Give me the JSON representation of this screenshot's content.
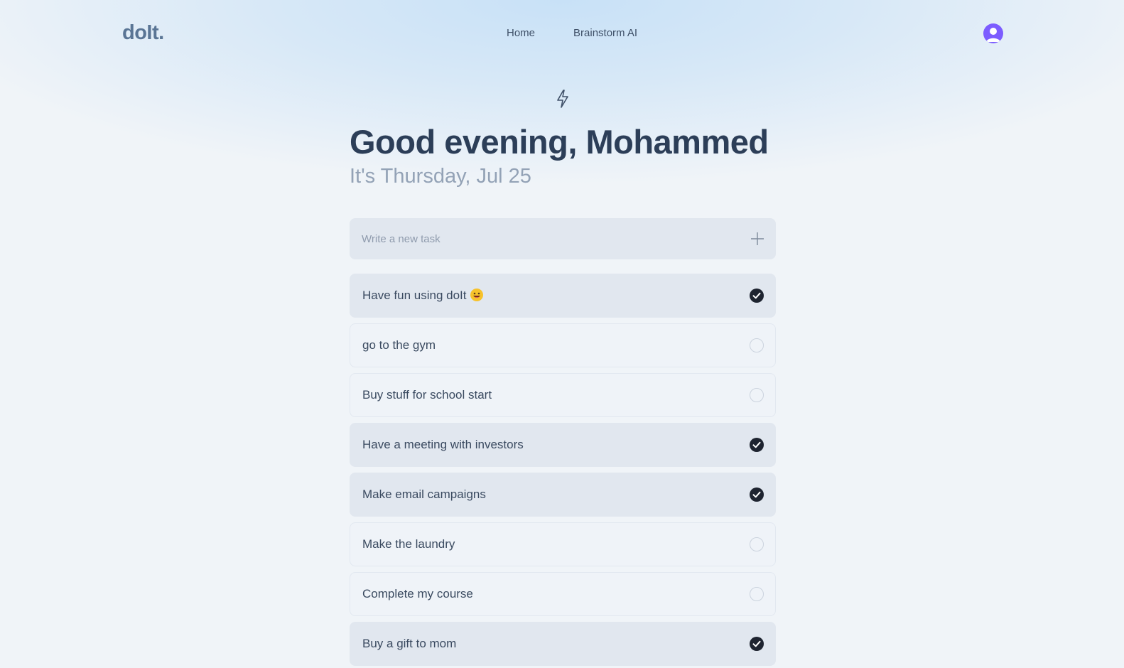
{
  "app": {
    "logo": "doIt."
  },
  "nav": {
    "items": [
      {
        "label": "Home"
      },
      {
        "label": "Brainstorm AI"
      }
    ]
  },
  "user": {
    "avatar_icon": "user-avatar-icon",
    "avatar_color": "#7c5cff"
  },
  "hero": {
    "icon": "lightning-bolt-icon",
    "greeting": "Good evening, Mohammed",
    "date": "It's Thursday, Jul 25"
  },
  "new_task": {
    "placeholder": "Write a new task",
    "add_icon": "plus-icon"
  },
  "tasks": [
    {
      "label": "Have fun using doIt",
      "emoji": "grinning-face-emoji",
      "done": true
    },
    {
      "label": "go to the gym",
      "done": false
    },
    {
      "label": "Buy stuff for school start",
      "done": false
    },
    {
      "label": "Have a meeting with investors",
      "done": true
    },
    {
      "label": "Make email campaigns",
      "done": true
    },
    {
      "label": "Make the laundry",
      "done": false
    },
    {
      "label": "Complete my course",
      "done": false
    },
    {
      "label": "Buy a gift to mom",
      "done": true
    }
  ],
  "colors": {
    "accent": "#7c5cff",
    "checked": "#1e2430",
    "heading": "#2c3e58",
    "subheading": "#93a2b6"
  }
}
